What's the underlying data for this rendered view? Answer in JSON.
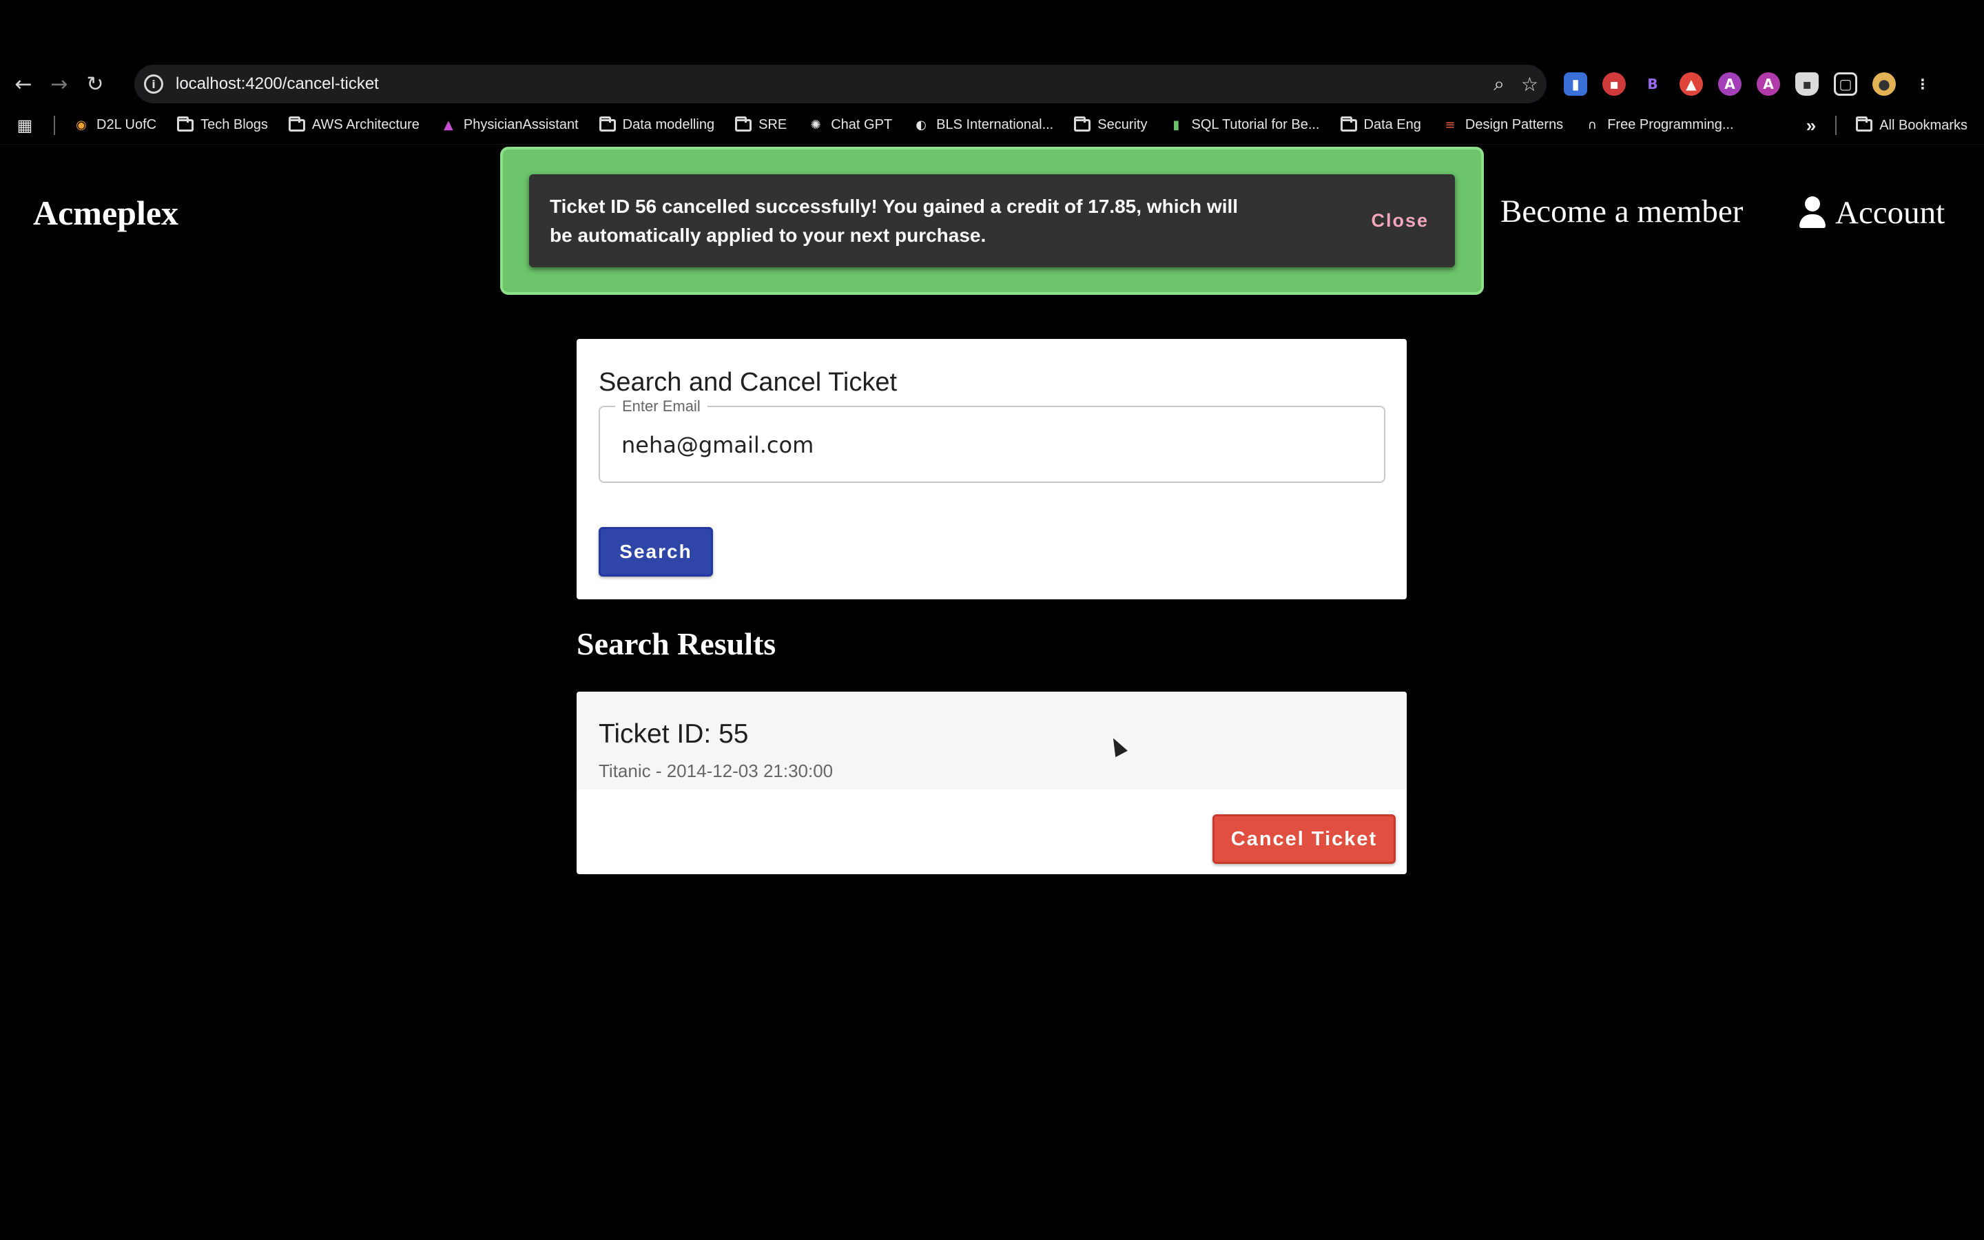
{
  "browser": {
    "url": "localhost:4200/cancel-ticket",
    "bookmarks": [
      {
        "label": "D2L UofC",
        "icon": "d2l-icon"
      },
      {
        "label": "Tech Blogs",
        "icon": "folder-icon"
      },
      {
        "label": "AWS Architecture",
        "icon": "folder-icon"
      },
      {
        "label": "PhysicianAssistant",
        "icon": "angular-icon"
      },
      {
        "label": "Data modelling",
        "icon": "folder-icon"
      },
      {
        "label": "SRE",
        "icon": "folder-icon"
      },
      {
        "label": "Chat GPT",
        "icon": "chatgpt-icon"
      },
      {
        "label": "BLS International...",
        "icon": "globe-icon"
      },
      {
        "label": "Security",
        "icon": "folder-icon"
      },
      {
        "label": "SQL Tutorial for Be...",
        "icon": "sql-icon"
      },
      {
        "label": "Data Eng",
        "icon": "folder-icon"
      },
      {
        "label": "Design Patterns",
        "icon": "design-patterns-icon"
      },
      {
        "label": "Free Programming...",
        "icon": "headphones-icon"
      }
    ],
    "all_bookmarks_label": "All Bookmarks",
    "overflow_label": "»"
  },
  "header": {
    "brand": "Acmeplex",
    "become_member": "Become a member",
    "account": "Account"
  },
  "toast": {
    "message": "Ticket ID 56 cancelled successfully! You gained a credit of 17.85, which will be automatically applied to your next purchase.",
    "close_label": "Close"
  },
  "search_card": {
    "title": "Search and Cancel Ticket",
    "email_label": "Enter Email",
    "email_value": "neha@gmail.com",
    "search_label": "Search"
  },
  "results": {
    "title": "Search Results",
    "items": [
      {
        "ticket_id": "Ticket ID: 55",
        "details": "Titanic - 2014-12-03 21:30:00",
        "cancel_label": "Cancel Ticket"
      }
    ]
  }
}
